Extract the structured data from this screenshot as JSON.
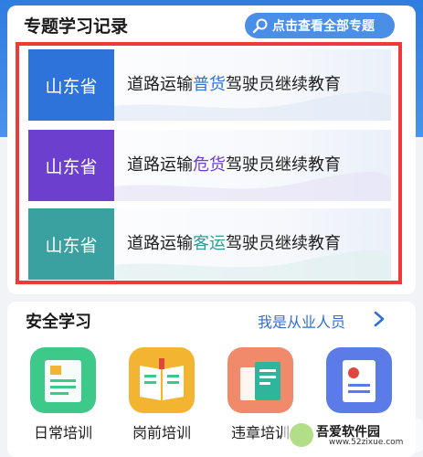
{
  "topic_section": {
    "title": "专题学习记录",
    "view_all_label": "点击查看全部专题",
    "courses": [
      {
        "province": "山东省",
        "prefix": "道路运输",
        "highlight": "普货",
        "suffix": "驾驶员继续教育",
        "badge_color": "#2e73d9",
        "highlight_color": "#2e73d9"
      },
      {
        "province": "山东省",
        "prefix": "道路运输",
        "highlight": "危货",
        "suffix": "驾驶员继续教育",
        "badge_color": "#6c3fcf",
        "highlight_color": "#6c3fcf"
      },
      {
        "province": "山东省",
        "prefix": "道路运输",
        "highlight": "客运",
        "suffix": "驾驶员继续教育",
        "badge_color": "#3aa0a0",
        "highlight_color": "#2f9b9b"
      }
    ]
  },
  "safety_section": {
    "title": "安全学习",
    "worker_link": "我是从业人员",
    "categories": [
      {
        "label": "日常培训",
        "color": "#3dc98a",
        "icon": "book-icon"
      },
      {
        "label": "岗前培训",
        "color": "#f3b531",
        "icon": "open-book-icon"
      },
      {
        "label": "违章培训",
        "color": "#f08a6a",
        "icon": "books-icon"
      },
      {
        "label": "",
        "color": "#5b7be8",
        "icon": "document-icon"
      }
    ]
  },
  "watermark": {
    "text": "吾爱软件园",
    "url": "www.52zixue.com"
  }
}
